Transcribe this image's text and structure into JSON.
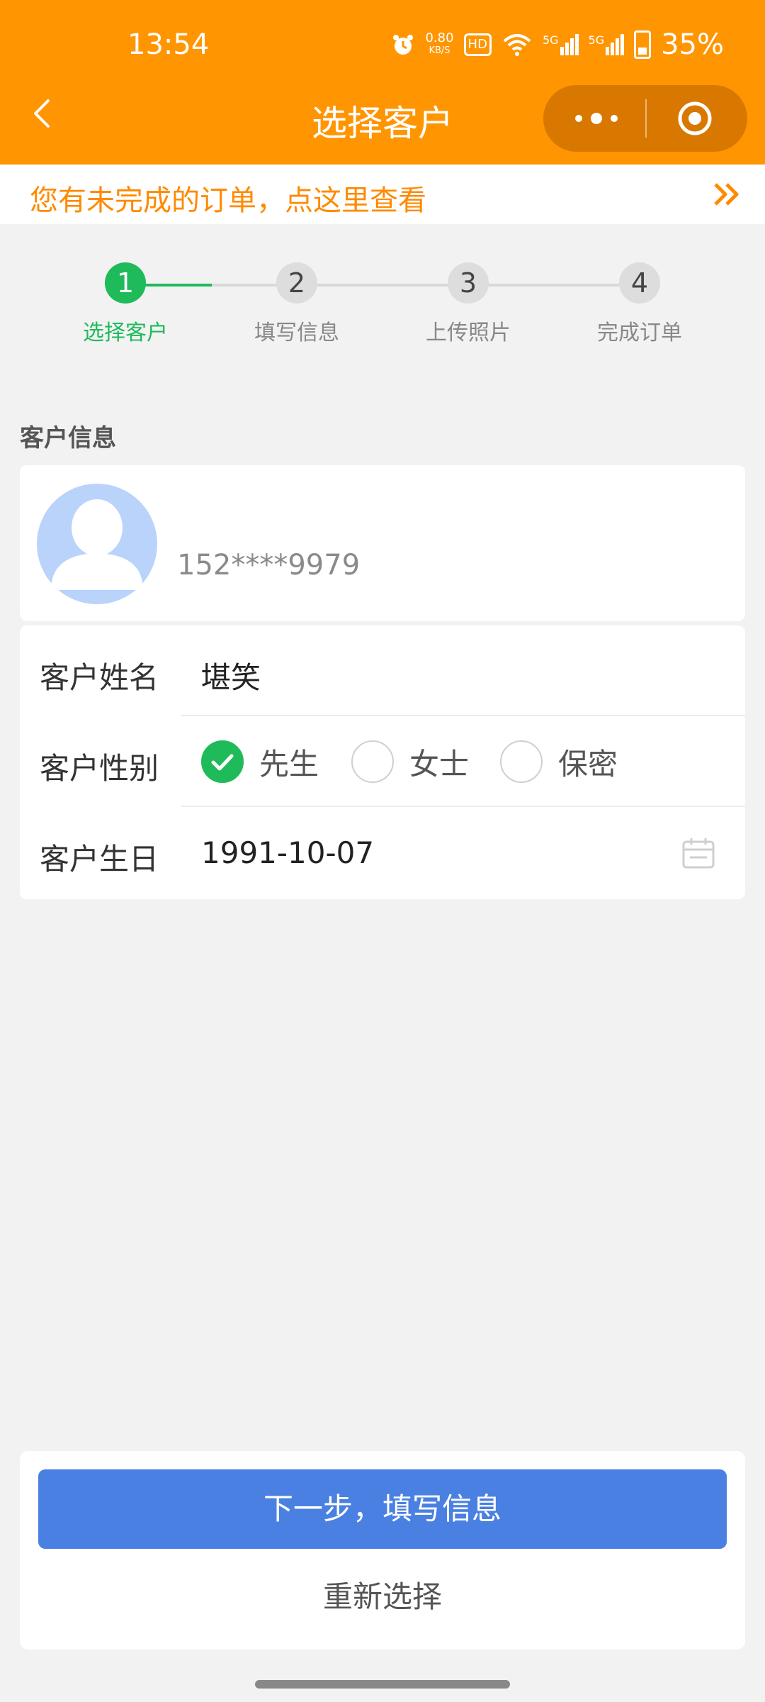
{
  "status_bar": {
    "time": "13:54",
    "net_speed_value": "0.80",
    "net_speed_unit": "KB/S",
    "hd_badge": "HD",
    "signal1": "5G",
    "signal2": "5G",
    "battery": "35%",
    "icons": [
      "alarm-icon",
      "wifi-icon",
      "signal-icon",
      "battery-icon"
    ]
  },
  "nav": {
    "title": "选择客户",
    "back_icon": "chevron-left-icon",
    "menu_icons": [
      "more-icon",
      "target-icon"
    ]
  },
  "banner": {
    "text": "您有未完成的订单，点这里查看",
    "arrow_icon": "double-chevron-right-icon"
  },
  "steps": [
    {
      "number": "1",
      "label": "选择客户",
      "active": true
    },
    {
      "number": "2",
      "label": "填写信息",
      "active": false
    },
    {
      "number": "3",
      "label": "上传照片",
      "active": false
    },
    {
      "number": "4",
      "label": "完成订单",
      "active": false
    }
  ],
  "section": {
    "title": "客户信息",
    "phone": "152****9979"
  },
  "form": {
    "name_label": "客户姓名",
    "name_value": "堪笑",
    "gender_label": "客户性别",
    "gender_options": [
      "先生",
      "女士",
      "保密"
    ],
    "gender_selected": "先生",
    "birthday_label": "客户生日",
    "birthday_value": "1991-10-07"
  },
  "actions": {
    "next_label": "下一步，填写信息",
    "reselect_label": "重新选择"
  },
  "colors": {
    "header": "#ff9500",
    "banner_text": "#ff8a00",
    "active_green": "#1fba5a",
    "primary_button": "#4a80e2",
    "avatar_bg": "#b9d3fb"
  }
}
